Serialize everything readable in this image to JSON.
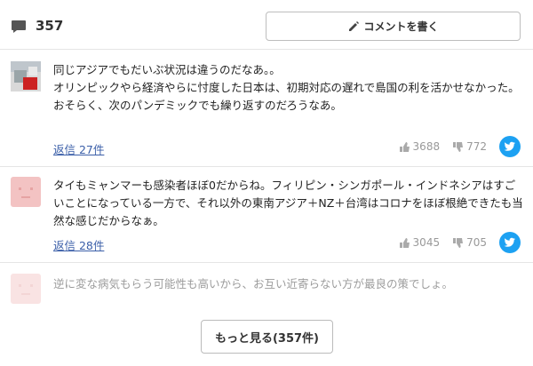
{
  "header": {
    "comment_count": "357",
    "write_label": "コメントを書く"
  },
  "comments": [
    {
      "text": "同じアジアでもだいぶ状況は違うのだなあ。。\nオリンピックやら経済やらに忖度した日本は、初期対応の遅れで島国の利を活かせなかった。\nおそらく、次のパンデミックでも繰り返すのだろうなあ。",
      "reply_label": "返信 27件",
      "likes": "3688",
      "dislikes": "772"
    },
    {
      "text": "タイもミャンマーも感染者ほぼ0だからね。フィリピン・シンガポール・インドネシアはすごいことになっている一方で、それ以外の東南アジア＋NZ＋台湾はコロナをほぼ根絶できたも当然な感じだからなぁ。",
      "reply_label": "返信 28件",
      "likes": "3045",
      "dislikes": "705"
    },
    {
      "text": "逆に変な病気もらう可能性も高いから、お互い近寄らない方が最良の策でしょ。"
    }
  ],
  "more_button_label": "もっと見る(357件)",
  "colors": {
    "link": "#3a5ea8",
    "twitter": "#1da1f2",
    "avatar_pink": "#f3c3c3"
  }
}
